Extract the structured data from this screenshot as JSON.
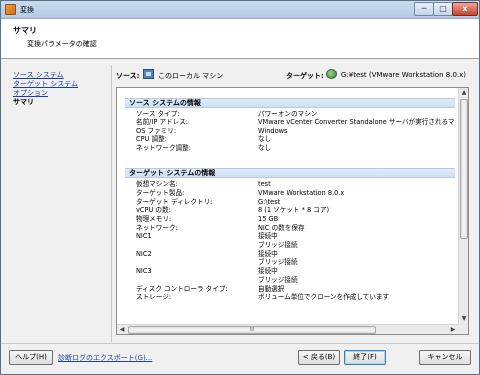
{
  "window": {
    "title": "変換"
  },
  "header": {
    "title": "サマリ",
    "subtitle": "変換パラメータの確認"
  },
  "sidebar": {
    "items": [
      {
        "label": "ソース システム"
      },
      {
        "label": "ターゲット システム"
      },
      {
        "label": "オプション"
      },
      {
        "label": "サマリ"
      }
    ]
  },
  "summary": {
    "source_label": "ソース:",
    "source_value": "このローカル マシン",
    "target_label": "ターゲット:",
    "target_value": "G:¥test (VMware Workstation 8.0.x)"
  },
  "source_section": {
    "title": "ソース システムの情報",
    "rows": [
      {
        "key": "ソース タイプ:",
        "value": "パワーオンのマシン"
      },
      {
        "key": "名前/IP アドレス:",
        "value": "VMware vCenter Converter Standalone サーバが実行されるマ"
      },
      {
        "key": "OS ファミリ:",
        "value": "Windows"
      },
      {
        "key": "CPU 調整:",
        "value": "なし"
      },
      {
        "key": "ネットワーク調整:",
        "value": "なし"
      }
    ]
  },
  "target_section": {
    "title": "ターゲット システムの情報",
    "rows": [
      {
        "key": "仮想マシン名:",
        "value": "test"
      },
      {
        "key": "ターゲット製品:",
        "value": "VMware Workstation 8.0.x"
      },
      {
        "key": "ターゲット ディレクトリ:",
        "value": "G:\\test"
      },
      {
        "key": "vCPU の数:",
        "value": "8 (1 ソケット * 8 コア)"
      },
      {
        "key": "物理メモリ:",
        "value": "15 GB"
      },
      {
        "key": "ネットワーク:",
        "value": "NIC の数を保存"
      },
      {
        "key": "NIC1",
        "value": "接続中"
      },
      {
        "key": "",
        "value": "ブリッジ接続"
      },
      {
        "key": "NIC2",
        "value": "接続中"
      },
      {
        "key": "",
        "value": "ブリッジ接続"
      },
      {
        "key": "NIC3",
        "value": "接続中"
      },
      {
        "key": "",
        "value": "ブリッジ接続"
      },
      {
        "key": "ディスク コントローラ タイプ:",
        "value": "自動選択"
      },
      {
        "key": "ストレージ:",
        "value": "ボリューム単位でクローンを作成しています"
      }
    ]
  },
  "footer": {
    "help_label": "ヘルプ(H)",
    "export_log_label": "診断ログのエクスポート(G)...",
    "back_label": "< 戻る(B)",
    "finish_label": "終了(F)",
    "cancel_label": "キャンセル"
  },
  "icons": {
    "minimize": "─",
    "maximize": "□",
    "close": "x",
    "scroll_up": "▲",
    "scroll_down": "▼",
    "scroll_left": "◀",
    "scroll_right": "▶",
    "grip": "III"
  },
  "colors": {
    "link": "#1a3fa8",
    "section_header": "#cfe0f2"
  }
}
